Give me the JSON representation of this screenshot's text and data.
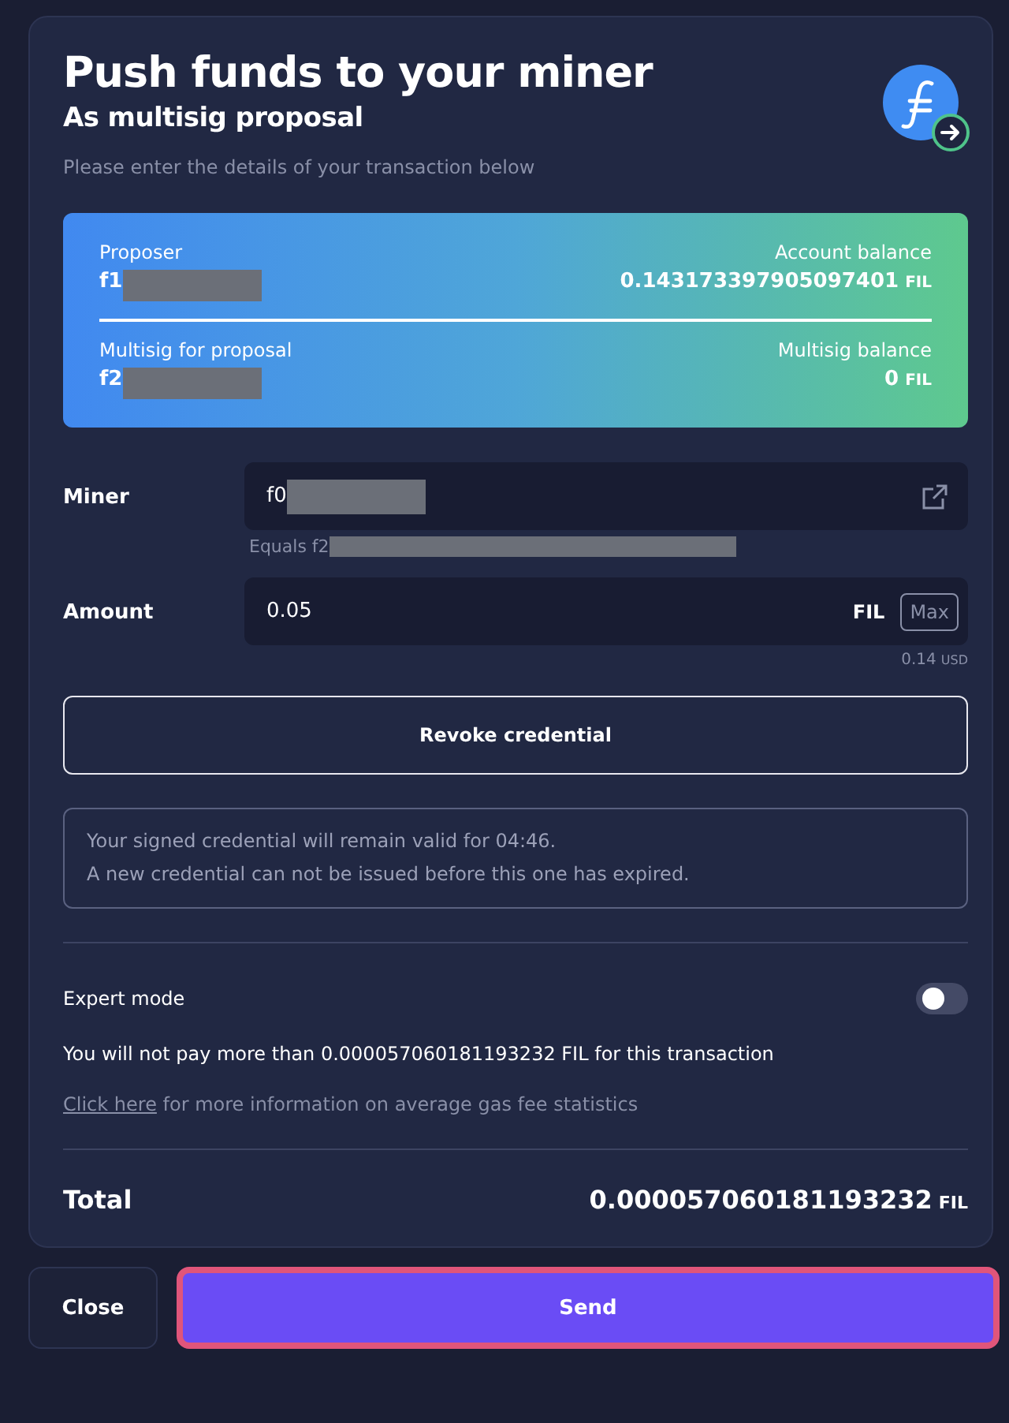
{
  "header": {
    "title": "Push funds to your miner",
    "subtitle": "As multisig proposal",
    "hint": "Please enter the details of your transaction below"
  },
  "summary": [
    {
      "label": "Proposer",
      "address": "f1",
      "balance_label": "Account balance",
      "balance": "0.143173397905097401",
      "unit": "FIL"
    },
    {
      "label": "Multisig for proposal",
      "address": "f2",
      "balance_label": "Multisig balance",
      "balance": "0",
      "unit": "FIL"
    }
  ],
  "miner": {
    "label": "Miner",
    "value": "f0",
    "equals": "Equals f2"
  },
  "amount": {
    "label": "Amount",
    "value": "0.05",
    "unit": "FIL",
    "max_button": "Max",
    "usd_value": "0.14",
    "usd_unit": "USD"
  },
  "revoke_button": "Revoke credential",
  "notice": [
    "Your signed credential will remain valid for 04:46.",
    "A new credential can not be issued before this one has expired."
  ],
  "expert_mode": {
    "label": "Expert mode",
    "on": false
  },
  "fee_note": "You will not pay more than 0.000057060181193232 FIL for this transaction",
  "gas_info": {
    "link": "Click here",
    "text": "for more information on average gas fee statistics"
  },
  "total": {
    "label": "Total",
    "value": "0.000057060181193232",
    "unit": "FIL"
  },
  "buttons": [
    {
      "label": "Close",
      "kind": "secondary"
    },
    {
      "label": "Send",
      "kind": "primary"
    }
  ]
}
